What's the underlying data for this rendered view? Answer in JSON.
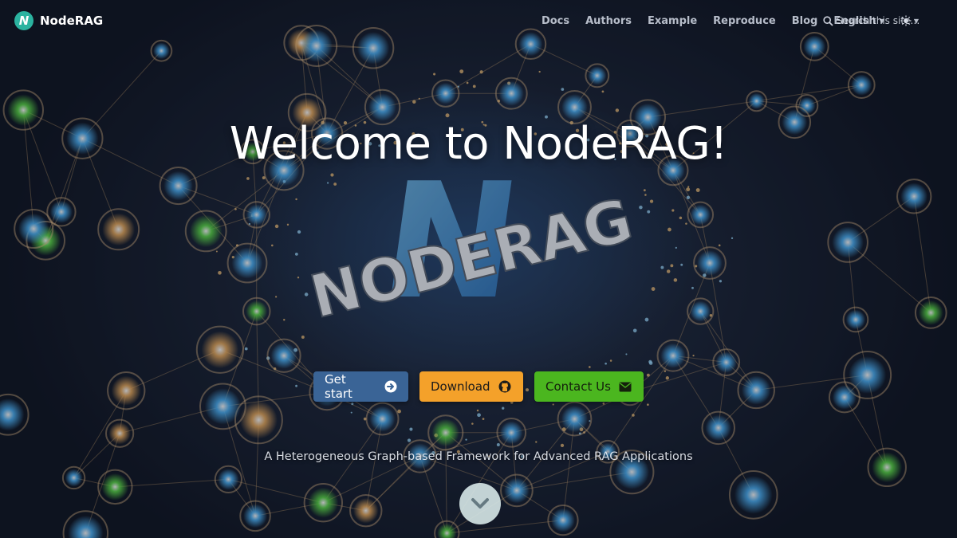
{
  "navbar": {
    "brand_logo_letter": "N",
    "brand_name": "NodeRAG",
    "links": [
      {
        "label": "Docs"
      },
      {
        "label": "Authors"
      },
      {
        "label": "Example"
      },
      {
        "label": "Reproduce"
      },
      {
        "label": "Blog"
      }
    ],
    "language": "English",
    "theme_icon": "sun-icon",
    "search": {
      "placeholder": "Search this site…",
      "icon": "search-icon"
    }
  },
  "hero": {
    "title": "Welcome to NodeRAG!",
    "background_logo_text": "NODERAG",
    "background_logo_letter": "N",
    "buttons": [
      {
        "label": "Get start",
        "icon": "arrow-circle-right-icon",
        "color": "#3a6496"
      },
      {
        "label": "Download",
        "icon": "github-icon",
        "color": "#f4a12a"
      },
      {
        "label": "Contact Us",
        "icon": "envelope-icon",
        "color": "#4bb61f"
      }
    ],
    "subtitle": "A Heterogeneous Graph-based Framework for Advanced RAG Applications",
    "scroll_icon": "chevron-down-icon"
  },
  "colors": {
    "brand": "#2bb3a0",
    "node_blue": "#4fb8ff",
    "node_green": "#5ee04a",
    "node_orange": "#f0b060"
  }
}
